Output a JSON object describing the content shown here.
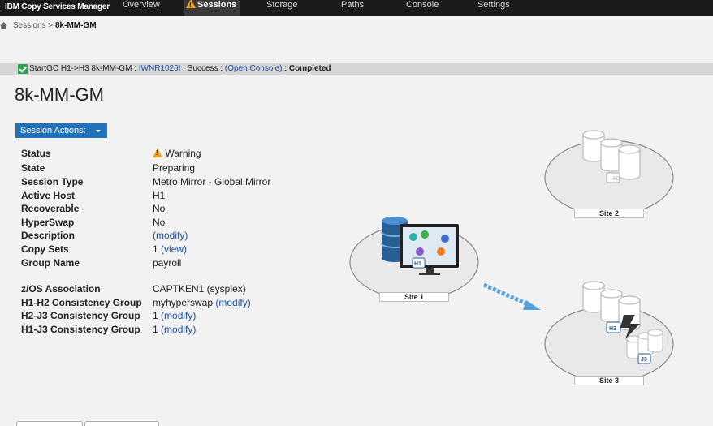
{
  "app": {
    "brand": "IBM Copy Services Manager"
  },
  "nav": {
    "overview": "Overview",
    "sessions": "Sessions",
    "storage": "Storage",
    "paths": "Paths",
    "console": "Console",
    "settings": "Settings"
  },
  "breadcrumb": {
    "parent": "Sessions",
    "sep": ">",
    "current": "8k-MM-GM"
  },
  "status_message": {
    "prefix": "StartGC H1->H3 8k-MM-GM : ",
    "code": "IWNR1026I",
    "mid": " : Success : ",
    "console_link": "(Open Console)",
    "sep": " : ",
    "result": "Completed"
  },
  "page_title": "8k-MM-GM",
  "session_actions_label": "Session Actions:",
  "properties": {
    "status_label": "Status",
    "status_value": "Warning",
    "state_label": "State",
    "state_value": "Preparing",
    "type_label": "Session Type",
    "type_value": "Metro Mirror - Global Mirror",
    "host_label": "Active Host",
    "host_value": "H1",
    "recoverable_label": "Recoverable",
    "recoverable_value": "No",
    "hyperswap_label": "HyperSwap",
    "hyperswap_value": "No",
    "description_label": "Description",
    "description_modify": "(modify)",
    "copysets_label": "Copy Sets",
    "copysets_count": "1",
    "copysets_view": "(view)",
    "group_label": "Group Name",
    "group_value": "payroll",
    "zos_label": "z/OS Association",
    "zos_value": "CAPTKEN1 (sysplex)",
    "h1h2_label": "H1-H2 Consistency Group",
    "h1h2_value": "myhyperswap",
    "h1h2_modify": "(modify)",
    "h2j3_label": "H2-J3 Consistency Group",
    "h2j3_value": "1",
    "h2j3_modify": "(modify)",
    "h1j3_label": "H1-J3 Consistency Group",
    "h1j3_value": "1",
    "h1j3_modify": "(modify)"
  },
  "diagram": {
    "site1": "Site 1",
    "site2": "Site 2",
    "site3": "Site 3",
    "h1": "H1",
    "h2": "H2",
    "h3": "H3",
    "j3": "J3"
  },
  "colors": {
    "accent": "#2172b8",
    "warning": "#f0a020",
    "success": "#2da44e",
    "link": "#1a4fa0"
  }
}
